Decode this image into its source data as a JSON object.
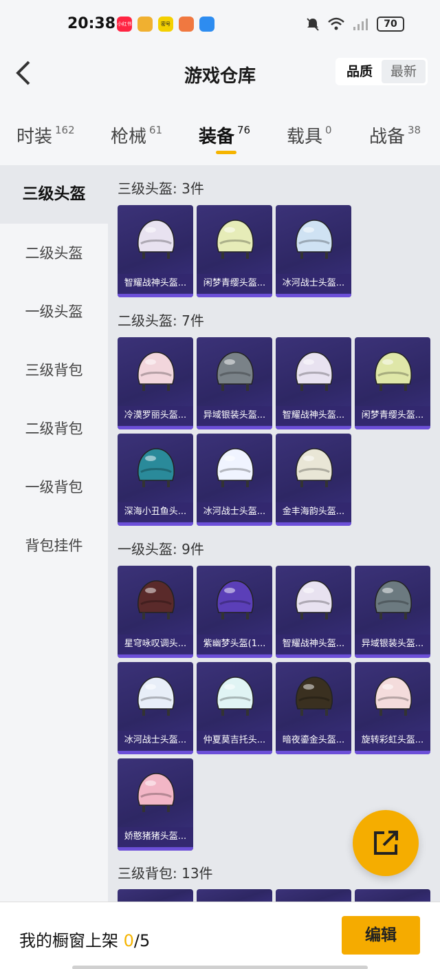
{
  "status_bar": {
    "time": "20:38",
    "apps": [
      {
        "icon": "xiaohongshu-app-icon",
        "label": "小红书",
        "color": "#ff2442"
      },
      {
        "icon": "game-app-icon",
        "label": "",
        "color": "#f0b030"
      },
      {
        "icon": "mihao-app-icon",
        "label": "密号",
        "color": "#f4d000"
      },
      {
        "icon": "orange-app-icon",
        "label": "",
        "color": "#f07840"
      },
      {
        "icon": "blue-app-icon",
        "label": "",
        "color": "#2d8cf0"
      }
    ],
    "battery": "70"
  },
  "header": {
    "title": "游戏仓库",
    "sort_quality": "品质",
    "sort_latest": "最新"
  },
  "tabs": [
    {
      "label": "时装",
      "count": "162"
    },
    {
      "label": "枪械",
      "count": "61"
    },
    {
      "label": "装备",
      "count": "76"
    },
    {
      "label": "载具",
      "count": "0"
    },
    {
      "label": "战备",
      "count": "38"
    }
  ],
  "sidebar": [
    {
      "label": "三级头盔"
    },
    {
      "label": "二级头盔"
    },
    {
      "label": "一级头盔"
    },
    {
      "label": "三级背包"
    },
    {
      "label": "二级背包"
    },
    {
      "label": "一级背包"
    },
    {
      "label": "背包挂件"
    }
  ],
  "sections": [
    {
      "title": "三级头盔: 3件",
      "items": [
        {
          "name": "智耀战神头盔..."
        },
        {
          "name": "闲梦青缨头盔..."
        },
        {
          "name": "冰河战士头盔..."
        }
      ]
    },
    {
      "title": "二级头盔: 7件",
      "items": [
        {
          "name": "冷漠罗丽头盔..."
        },
        {
          "name": "异域银装头盔..."
        },
        {
          "name": "智耀战神头盔..."
        },
        {
          "name": "闲梦青缨头盔..."
        },
        {
          "name": "深海小丑鱼头..."
        },
        {
          "name": "冰河战士头盔..."
        },
        {
          "name": "金丰海韵头盔..."
        }
      ]
    },
    {
      "title": "一级头盔: 9件",
      "items": [
        {
          "name": "星穹咏叹调头..."
        },
        {
          "name": "紫幽梦头盔(1..."
        },
        {
          "name": "智耀战神头盔..."
        },
        {
          "name": "异域银装头盔..."
        },
        {
          "name": "冰河战士头盔..."
        },
        {
          "name": "仲夏莫吉托头..."
        },
        {
          "name": "暗夜鎏金头盔..."
        },
        {
          "name": "旋转彩虹头盔..."
        },
        {
          "name": "娇憨猪猪头盔..."
        }
      ]
    },
    {
      "title": "三级背包: 13件",
      "items": []
    }
  ],
  "bottom": {
    "shelf_label": "我的橱窗上架 ",
    "shelf_current": "0",
    "shelf_total": "/5",
    "edit_label": "编辑"
  },
  "colors": {
    "accent": "#f5ab00",
    "card_bg": "#2e2764",
    "card_bar": "#6c4fd8"
  }
}
